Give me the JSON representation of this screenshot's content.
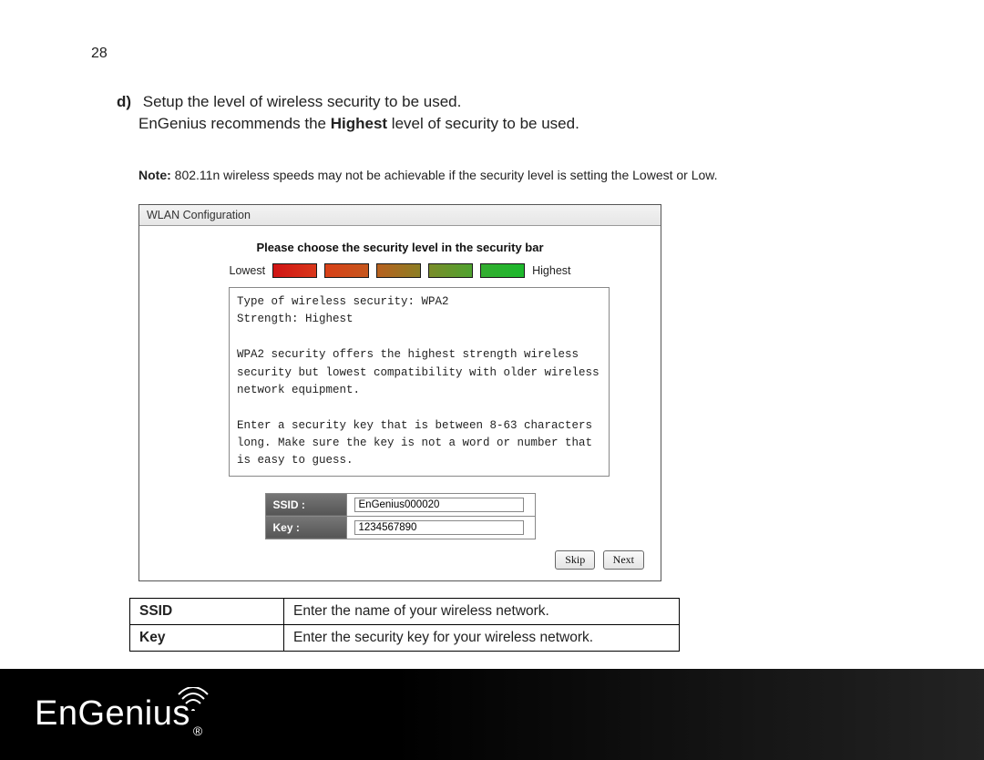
{
  "page_number": "28",
  "step": {
    "letter": "d)",
    "line1": "Setup the level of wireless security to be used.",
    "line2_pre": "EnGenius recommends the ",
    "line2_strong": "Highest",
    "line2_post": " level of security to be used."
  },
  "note": {
    "label": "Note:",
    "text": " 802.11n wireless speeds may not be achievable if the security level is setting the Lowest or Low."
  },
  "panel": {
    "title": "WLAN Configuration",
    "heading": "Please choose the security level in the security bar",
    "low_label": "Lowest",
    "high_label": "Highest",
    "info_text": "Type of wireless security: WPA2\nStrength: Highest\n\nWPA2 security offers the highest strength wireless security but lowest compatibility with older wireless network equipment.\n\nEnter a security key that is between 8-63 characters long. Make sure the key is not a word or number that is easy to guess.",
    "ssid_label": "SSID :",
    "ssid_value": "EnGenius000020",
    "key_label": "Key :",
    "key_value": "1234567890",
    "skip_label": "Skip",
    "next_label": "Next"
  },
  "desc_table": {
    "rows": [
      {
        "name": "SSID",
        "desc": "Enter the name of your wireless network."
      },
      {
        "name": "Key",
        "desc": "Enter the security key for your wireless network."
      }
    ]
  },
  "footer": {
    "brand": "EnGenius",
    "reg": "®"
  }
}
